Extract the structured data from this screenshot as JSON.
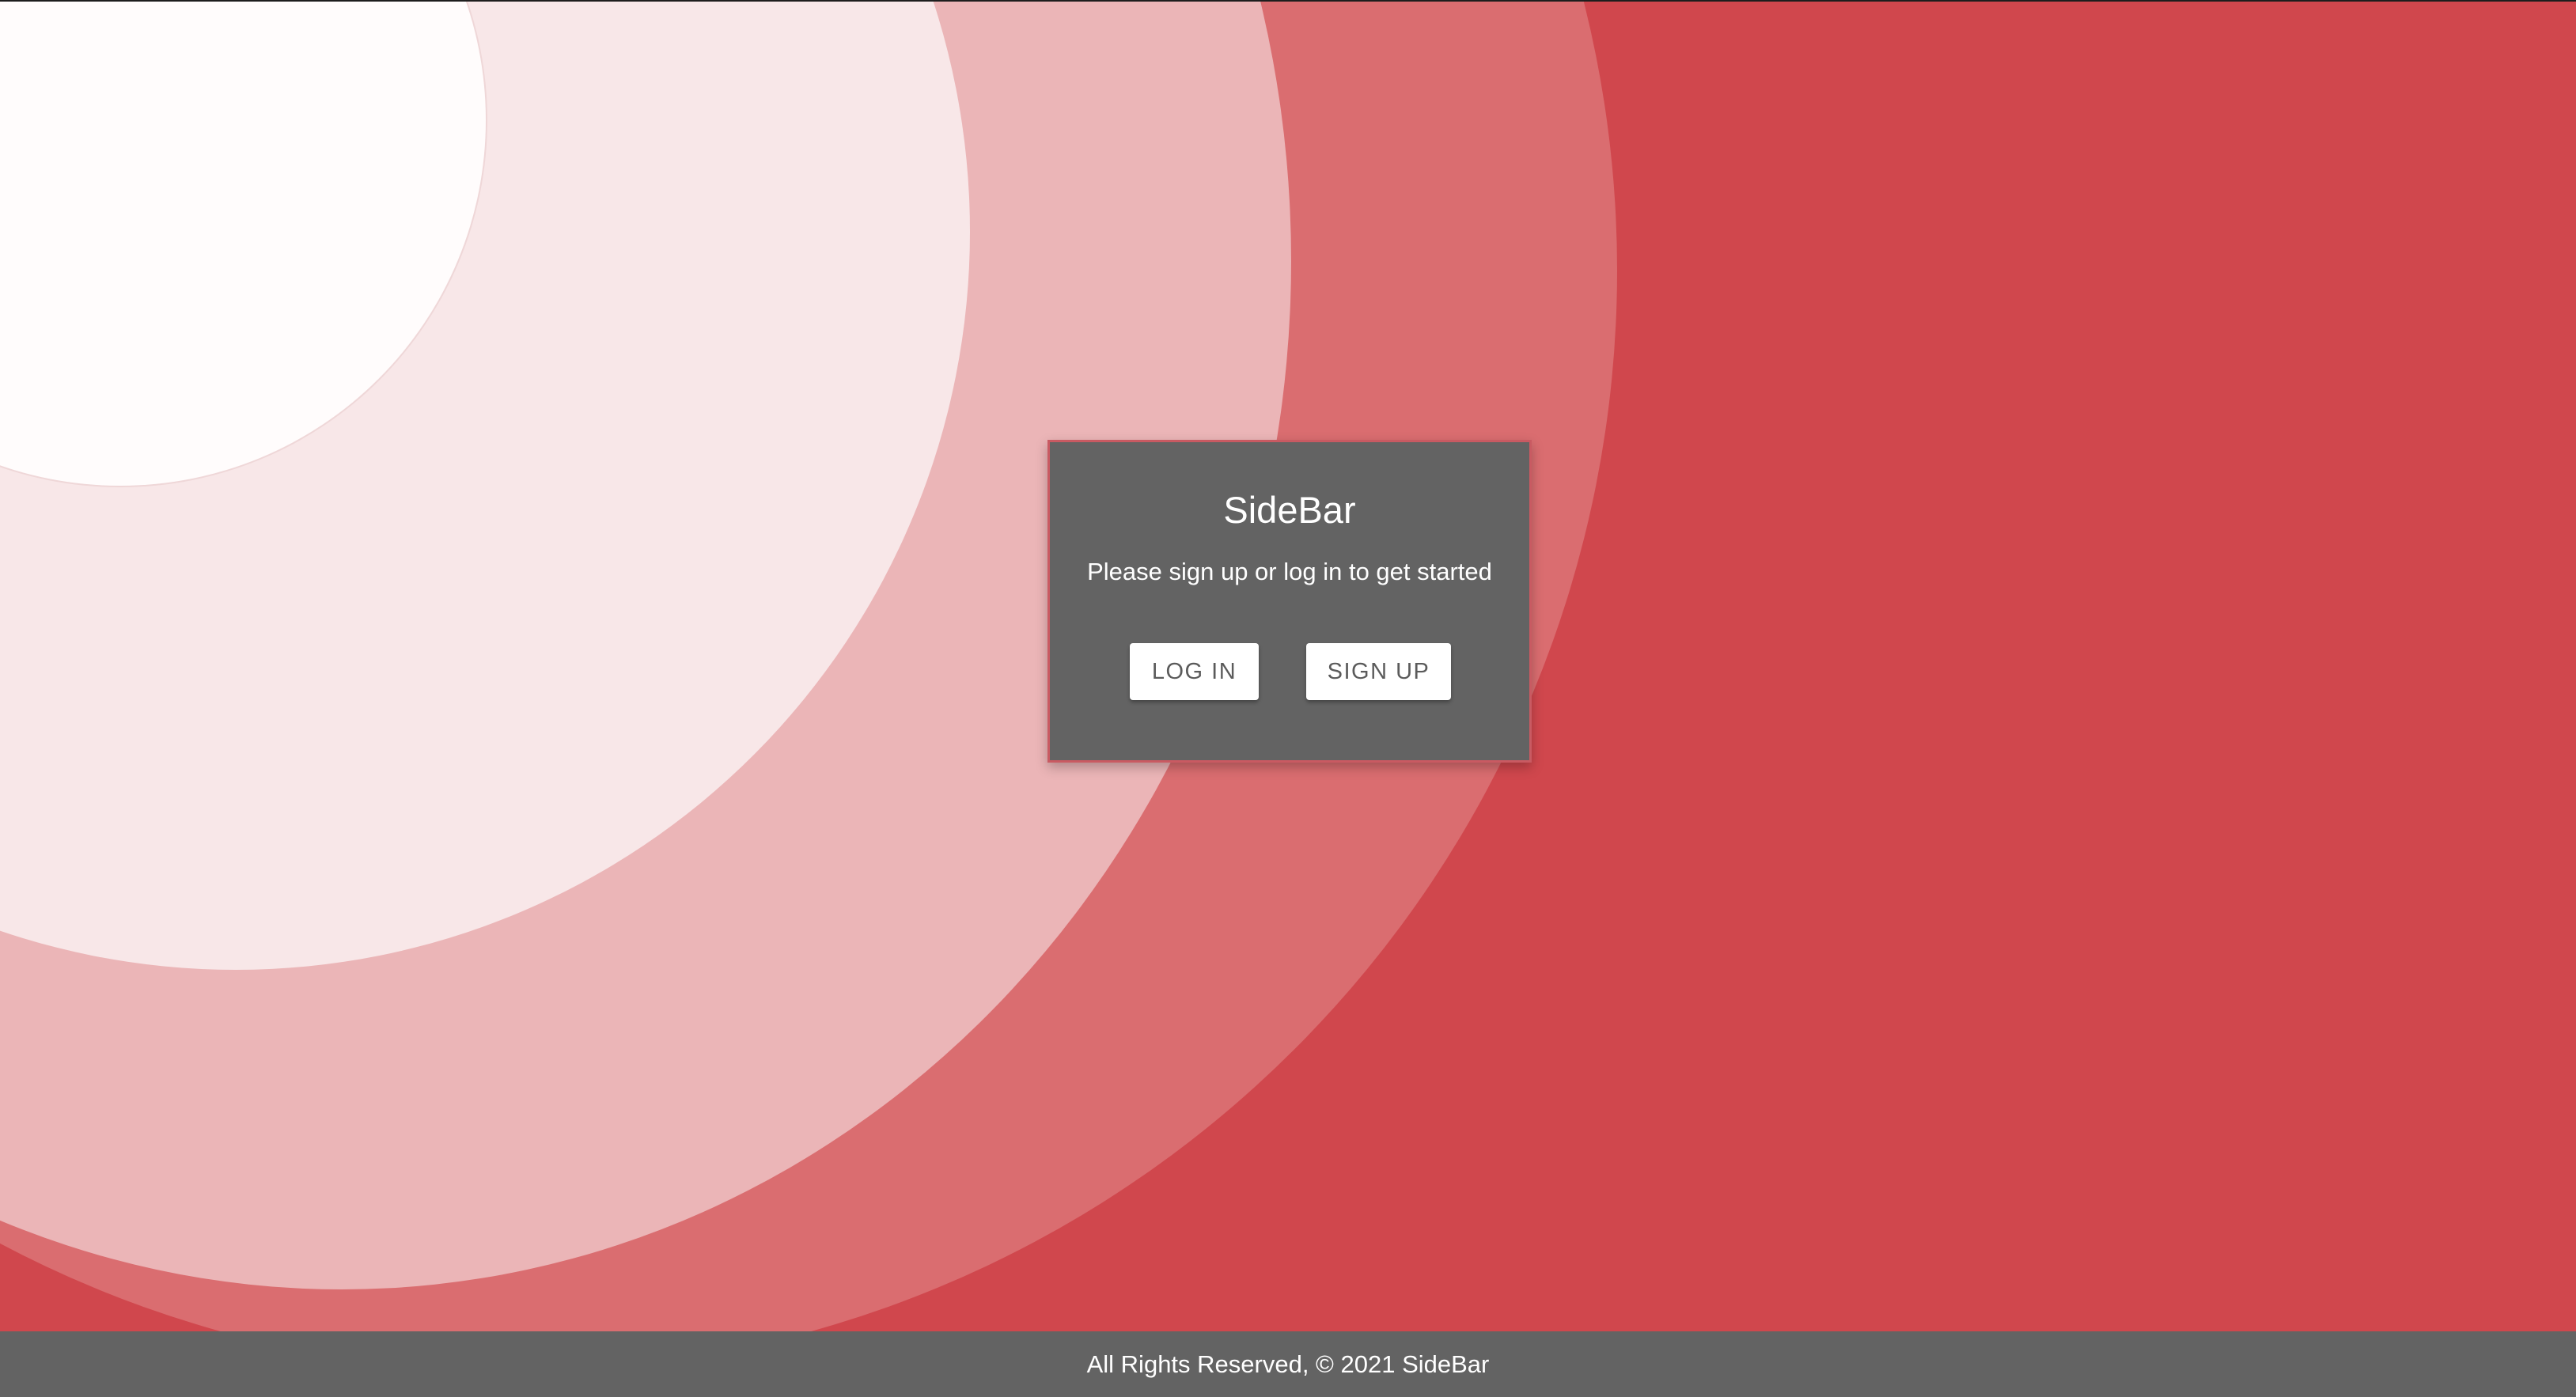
{
  "app": {
    "title": "SideBar"
  },
  "card": {
    "title": "SideBar",
    "subtitle": "Please sign up or log in to get started",
    "login_label": "LOG IN",
    "signup_label": "SIGN UP"
  },
  "footer": {
    "text": "All Rights Reserved, © 2021 SideBar"
  },
  "colors": {
    "background": "#d0474d",
    "circle_outer": "#da6d70",
    "circle_mid": "#ebb5b7",
    "circle_inner": "#f8e7e8",
    "circle_small": "#fffcfc",
    "card_background": "#636363",
    "footer_background": "#636363",
    "button_background": "#ffffff",
    "button_text": "#5b5b5b"
  }
}
